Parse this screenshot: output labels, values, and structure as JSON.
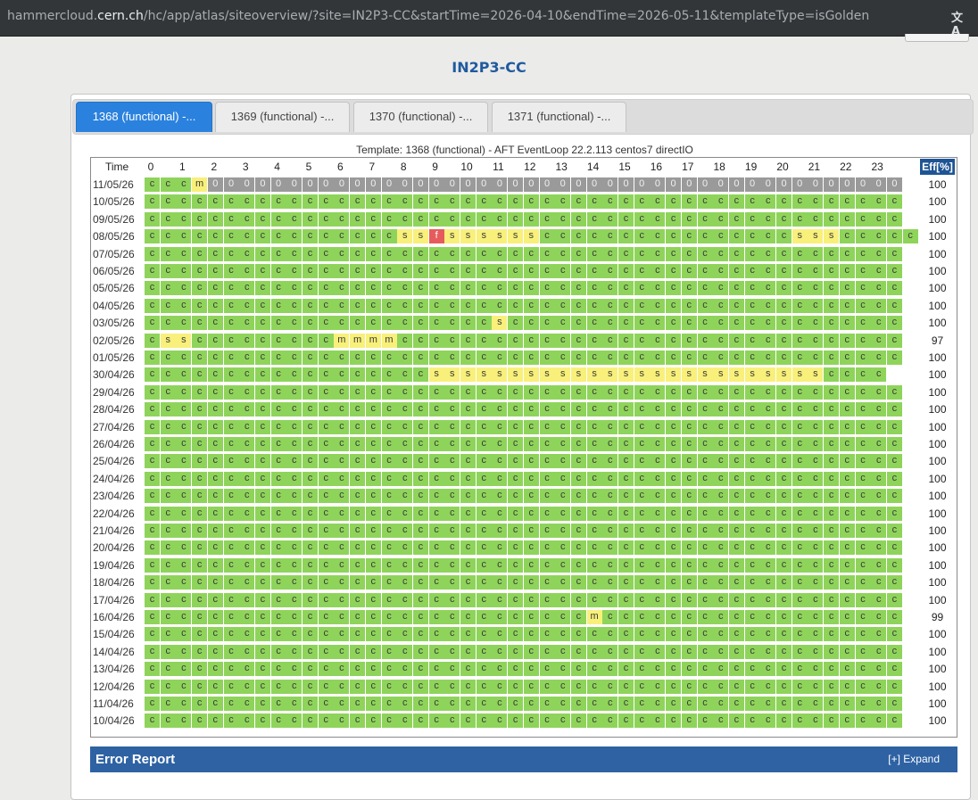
{
  "browser": {
    "url_host": "hammercloud.cern.ch",
    "url_prefix": "hammercloud.",
    "url_domain": "cern.ch",
    "url_path": "/hc/app/atlas/siteoverview/?site=IN2P3-CC&startTime=2026-04-10&endTime=2026-05-11&templateType=isGolden",
    "translate_icon": "translate-icon",
    "translate_glyph": "文A"
  },
  "page": {
    "title": "IN2P3-CC"
  },
  "tabs": [
    {
      "label": "1368 (functional) -...",
      "active": true
    },
    {
      "label": "1369 (functional) -...",
      "active": false
    },
    {
      "label": "1370 (functional) -...",
      "active": false
    },
    {
      "label": "1371 (functional) -...",
      "active": false
    }
  ],
  "grid": {
    "template_label": "Template: 1368 (functional) - AFT EventLoop 22.2.113 centos7 directIO",
    "time_header": "Time",
    "eff_header": "Eff[%]",
    "hours": [
      "0",
      "1",
      "2",
      "3",
      "4",
      "5",
      "6",
      "7",
      "8",
      "9",
      "10",
      "11",
      "12",
      "13",
      "14",
      "15",
      "16",
      "17",
      "18",
      "19",
      "20",
      "21",
      "22",
      "23"
    ],
    "rows": [
      {
        "date": "11/05/26",
        "eff": "100",
        "cells": "cccm00000000000000000000000000000000000000000000"
      },
      {
        "date": "10/05/26",
        "eff": "100",
        "cells": "cccccccccccccccccccccccccccccccccccccccccccccccc"
      },
      {
        "date": "09/05/26",
        "eff": "100",
        "cells": "cccccccccccccccccccccccccccccccccccccccccccccccc"
      },
      {
        "date": "08/05/26",
        "eff": "100",
        "cells": "ccccccccccccccccssfssssssccccccccccccccccssscccccc"
      },
      {
        "date": "07/05/26",
        "eff": "100",
        "cells": "cccccccccccccccccccccccccccccccccccccccccccccccc"
      },
      {
        "date": "06/05/26",
        "eff": "100",
        "cells": "cccccccccccccccccccccccccccccccccccccccccccccccc"
      },
      {
        "date": "05/05/26",
        "eff": "100",
        "cells": "cccccccccccccccccccccccccccccccccccccccccccccccc"
      },
      {
        "date": "04/05/26",
        "eff": "100",
        "cells": "cccccccccccccccccccccccccccccccccccccccccccccccc"
      },
      {
        "date": "03/05/26",
        "eff": "100",
        "cells": "ccccccccccccccccccccccsccccccccccccccccccccccccc"
      },
      {
        "date": "02/05/26",
        "eff": "97",
        "cells": "csscccccccccmmmmcccccccccccccccccccccccccccccccc"
      },
      {
        "date": "01/05/26",
        "eff": "100",
        "cells": "cccccccccccccccccccccccccccccccccccccccccccccccc"
      },
      {
        "date": "30/04/26",
        "eff": "100",
        "cells": "ccccccccccccccccccssssssssssssssssssssssssscccc"
      },
      {
        "date": "29/04/26",
        "eff": "100",
        "cells": "cccccccccccccccccccccccccccccccccccccccccccccccc"
      },
      {
        "date": "28/04/26",
        "eff": "100",
        "cells": "cccccccccccccccccccccccccccccccccccccccccccccccc"
      },
      {
        "date": "27/04/26",
        "eff": "100",
        "cells": "cccccccccccccccccccccccccccccccccccccccccccccccc"
      },
      {
        "date": "26/04/26",
        "eff": "100",
        "cells": "cccccccccccccccccccccccccccccccccccccccccccccccc"
      },
      {
        "date": "25/04/26",
        "eff": "100",
        "cells": "cccccccccccccccccccccccccccccccccccccccccccccccc"
      },
      {
        "date": "24/04/26",
        "eff": "100",
        "cells": "cccccccccccccccccccccccccccccccccccccccccccccccc"
      },
      {
        "date": "23/04/26",
        "eff": "100",
        "cells": "cccccccccccccccccccccccccccccccccccccccccccccccc"
      },
      {
        "date": "22/04/26",
        "eff": "100",
        "cells": "cccccccccccccccccccccccccccccccccccccccccccccccc"
      },
      {
        "date": "21/04/26",
        "eff": "100",
        "cells": "cccccccccccccccccccccccccccccccccccccccccccccccc"
      },
      {
        "date": "20/04/26",
        "eff": "100",
        "cells": "cccccccccccccccccccccccccccccccccccccccccccccccc"
      },
      {
        "date": "19/04/26",
        "eff": "100",
        "cells": "cccccccccccccccccccccccccccccccccccccccccccccccc"
      },
      {
        "date": "18/04/26",
        "eff": "100",
        "cells": "cccccccccccccccccccccccccccccccccccccccccccccccc"
      },
      {
        "date": "17/04/26",
        "eff": "100",
        "cells": "cccccccccccccccccccccccccccccccccccccccccccccccc"
      },
      {
        "date": "16/04/26",
        "eff": "99",
        "cells": "ccccccccccccccccccccccccccccmccccccccccccccccccc"
      },
      {
        "date": "15/04/26",
        "eff": "100",
        "cells": "cccccccccccccccccccccccccccccccccccccccccccccccc"
      },
      {
        "date": "14/04/26",
        "eff": "100",
        "cells": "cccccccccccccccccccccccccccccccccccccccccccccccc"
      },
      {
        "date": "13/04/26",
        "eff": "100",
        "cells": "cccccccccccccccccccccccccccccccccccccccccccccccc"
      },
      {
        "date": "12/04/26",
        "eff": "100",
        "cells": "cccccccccccccccccccccccccccccccccccccccccccccccc"
      },
      {
        "date": "11/04/26",
        "eff": "100",
        "cells": "cccccccccccccccccccccccccccccccccccccccccccccccc"
      },
      {
        "date": "10/04/26",
        "eff": "100",
        "cells": "cccccccccccccccccccccccccccccccccccccccccccccccc"
      }
    ]
  },
  "error_report": {
    "title": "Error Report",
    "expand_label": "[+] Expand"
  },
  "colors": {
    "status_c": "#8fd45a",
    "status_s": "#f8f07a",
    "status_m": "#f8f07a",
    "status_f": "#e65c5c",
    "status_0": "#9a9a9a",
    "accent": "#2b82de",
    "header_blue": "#1e5494"
  }
}
